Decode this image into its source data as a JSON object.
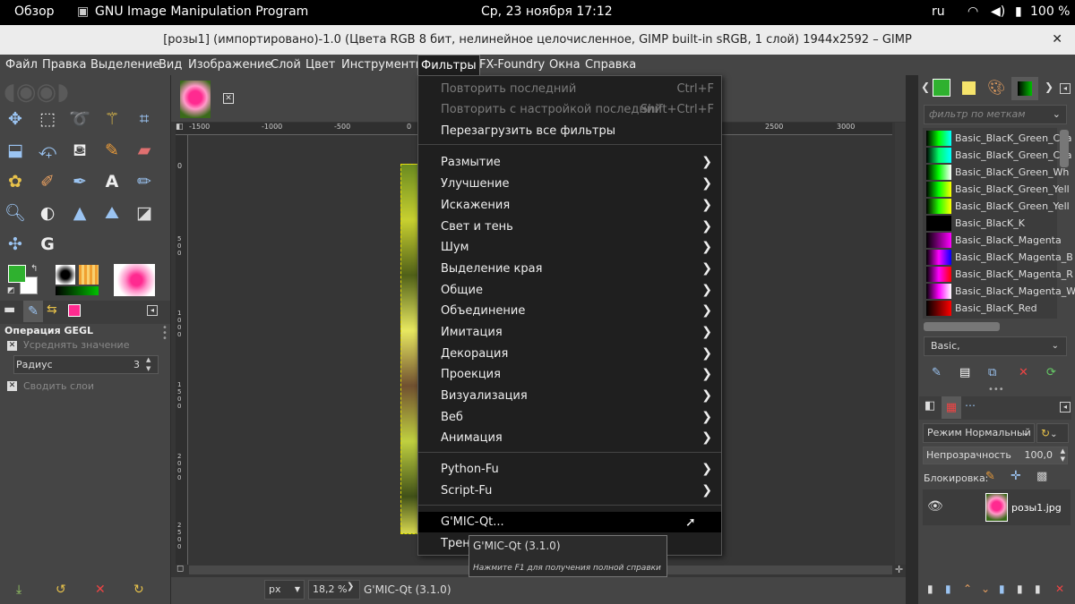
{
  "topbar": {
    "overview": "Обзор",
    "app": "GNU Image Manipulation Program",
    "datetime": "Ср, 23 ноября  17:12",
    "lang": "ru",
    "battery": "100 %"
  },
  "window": {
    "title": "[розы1] (импортировано)-1.0 (Цвета RGB 8 бит, нелинейное целочисленное, GIMP built-in sRGB, 1 слой) 1944x2592 – GIMP",
    "close": "✕"
  },
  "menubar": [
    "Файл",
    "Правка",
    "Выделение",
    "Вид",
    "Изображение",
    "Слой",
    "Цвет",
    "Инструменты",
    "Фильтры",
    "FX-Foundry",
    "Окна",
    "Справка"
  ],
  "filters_menu": {
    "repeat_last": "Повторить последний",
    "repeat_last_sc": "Ctrl+F",
    "reshow_last": "Повторить с настройкой последний",
    "reshow_last_sc": "Shift+Ctrl+F",
    "reset_all": "Перезагрузить все фильтры",
    "items": [
      "Размытие",
      "Улучшение",
      "Искажения",
      "Свет и тень",
      "Шум",
      "Выделение края",
      "Общие",
      "Объединение",
      "Имитация",
      "Декорация",
      "Проекция",
      "Визуализация",
      "Веб",
      "Анимация"
    ],
    "scripts": [
      "Python-Fu",
      "Script-Fu"
    ],
    "gmic": "G'MIC-Qt...",
    "last_partial": "Трени"
  },
  "tooltip": {
    "title": "G'MIC-Qt (3.1.0)",
    "hint": "Нажмите F1 для получения полной справки"
  },
  "tool_options": {
    "title": "Операция GEGL",
    "average": "Усреднять значение",
    "radius_label": "Радиус",
    "radius_value": "3",
    "merge": "Сводить слои"
  },
  "ruler": {
    "labels": [
      "-1500",
      "-1000",
      "-500",
      "0",
      "2500",
      "3000"
    ],
    "vlabels": [
      "0",
      "5 0 0",
      "1 0 0 0",
      "1 5 0 0",
      "2 0 0 0",
      "2 5 0 0"
    ]
  },
  "statusbar": {
    "unit": "px",
    "zoom": "18,2 %",
    "message": "G'MIC-Qt (3.1.0)"
  },
  "gradients": {
    "filter_placeholder": "фильтр по меткам",
    "items": [
      {
        "name": "Basic_BlacK_Green_Cya",
        "c1": "#00ff00",
        "c2": "#00ffff"
      },
      {
        "name": "Basic_BlacK_Green_Cya",
        "c1": "#00ff66",
        "c2": "#00ffff"
      },
      {
        "name": "Basic_BlacK_Green_Wh",
        "c1": "#00ff00",
        "c2": "#ffffff"
      },
      {
        "name": "Basic_BlacK_Green_Yell",
        "c1": "#00ff00",
        "c2": "#ffff00"
      },
      {
        "name": "Basic_BlacK_Green_Yell",
        "c1": "#22ff00",
        "c2": "#ffff00"
      },
      {
        "name": "Basic_BlacK_K",
        "c1": "#000000",
        "c2": "#111111"
      },
      {
        "name": "Basic_BlacK_Magenta",
        "c1": "#000000",
        "c2": "#ff00ff"
      },
      {
        "name": "Basic_BlacK_Magenta_B",
        "c1": "#ff00ff",
        "c2": "#0000ff"
      },
      {
        "name": "Basic_BlacK_Magenta_R",
        "c1": "#ff00ff",
        "c2": "#ff0000"
      },
      {
        "name": "Basic_BlacK_Magenta_W",
        "c1": "#ff00ff",
        "c2": "#ffffff"
      },
      {
        "name": "Basic_BlacK_Red",
        "c1": "#000000",
        "c2": "#ff0000"
      }
    ],
    "selected": "Basic,"
  },
  "layers": {
    "mode_label": "Режим",
    "mode": "Нормальный",
    "opacity_label": "Непрозрачность",
    "opacity": "100,0",
    "lock_label": "Блокировка:",
    "layer_name": "розы1.jpg"
  },
  "colors": {
    "accent": "#2fb12f",
    "menu_bg": "#1f1f1f",
    "panel_bg": "#454545"
  }
}
